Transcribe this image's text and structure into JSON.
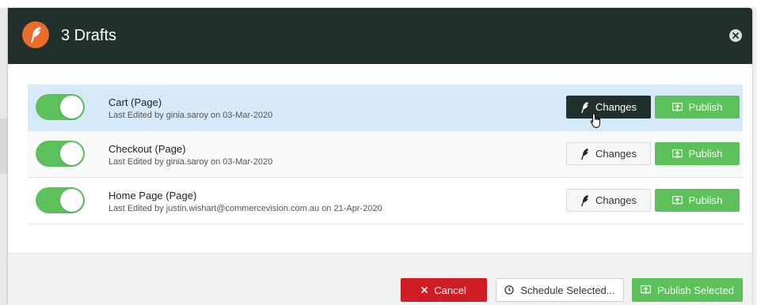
{
  "modal": {
    "title": "3 Drafts"
  },
  "drafts": [
    {
      "title": "Cart (Page)",
      "subtitle": "Last Edited by ginia.saroy on 03-Mar-2020",
      "changes_label": "Changes",
      "publish_label": "Publish",
      "enabled": true
    },
    {
      "title": "Checkout (Page)",
      "subtitle": "Last Edited by ginia.saroy on 03-Mar-2020",
      "changes_label": "Changes",
      "publish_label": "Publish",
      "enabled": true
    },
    {
      "title": "Home Page (Page)",
      "subtitle": "Last Edited by justin.wishart@commercevision.com.au on 21-Apr-2020",
      "changes_label": "Changes",
      "publish_label": "Publish",
      "enabled": true
    }
  ],
  "footer": {
    "cancel_label": "Cancel",
    "schedule_label": "Schedule Selected...",
    "publish_selected_label": "Publish Selected"
  },
  "colors": {
    "header": "#22302d",
    "accent_orange": "#ea6b2a",
    "publish_green": "#5cc15b",
    "cancel_red": "#d01c24",
    "row_highlight": "#d6e9f8"
  },
  "icons": {
    "logo": "feather-icon",
    "close": "close-circle-icon",
    "changes": "feather-icon",
    "publish": "publish-upload-icon",
    "cancel": "x-icon",
    "schedule": "clock-icon"
  }
}
